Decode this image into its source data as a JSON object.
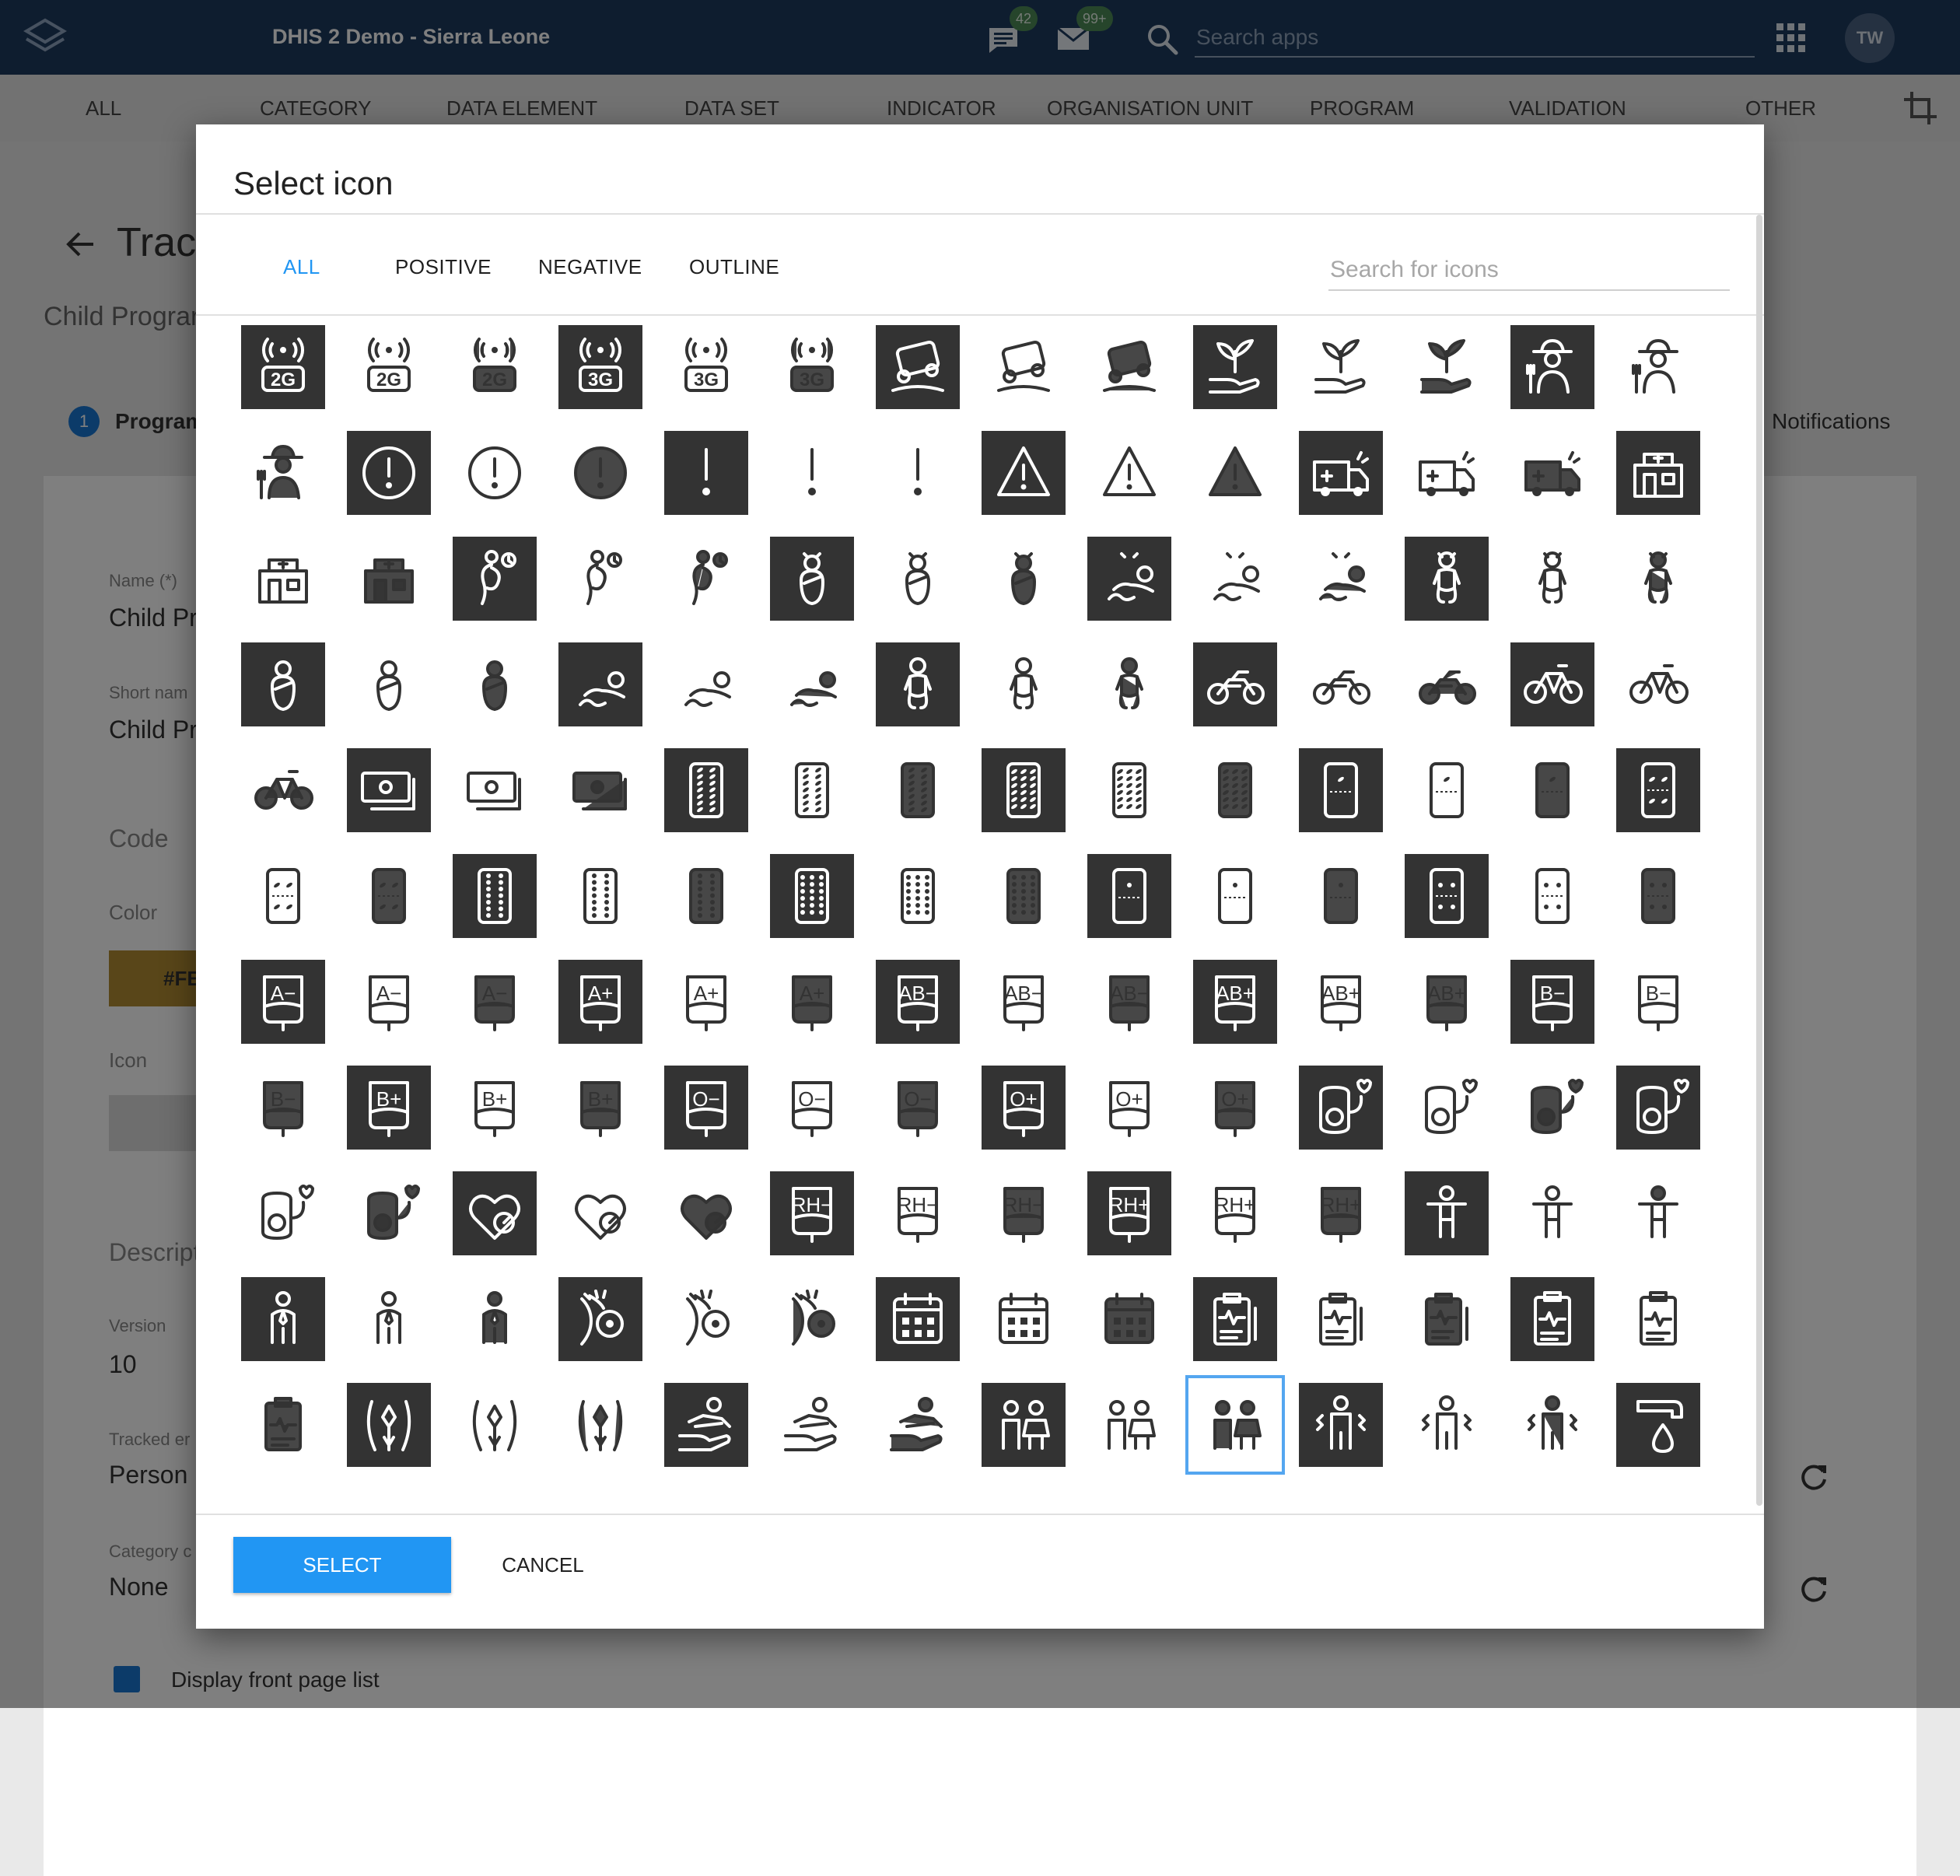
{
  "header": {
    "title": "DHIS 2 Demo - Sierra Leone",
    "messages_badge": "42",
    "interpretations_badge": "99+",
    "search_placeholder": "Search apps",
    "avatar_initials": "TW"
  },
  "top_tabs": [
    {
      "label": "ALL"
    },
    {
      "label": "CATEGORY"
    },
    {
      "label": "DATA ELEMENT"
    },
    {
      "label": "DATA SET"
    },
    {
      "label": "INDICATOR"
    },
    {
      "label": "ORGANISATION UNIT"
    },
    {
      "label": "PROGRAM"
    },
    {
      "label": "VALIDATION"
    },
    {
      "label": "OTHER"
    }
  ],
  "background": {
    "page_title": "Trac",
    "subtitle": "Child Prograr",
    "step_number": "1",
    "step_label": "Program",
    "notifications": "Notifications",
    "fields": {
      "name_label": "Name (*)",
      "name_value": "Child Pr",
      "short_label": "Short nam",
      "short_value": "Child Pr",
      "code_label": "Code",
      "color_label": "Color",
      "color_value": "#FE",
      "icon_label": "Icon",
      "description_label": "Descript",
      "version_label": "Version",
      "version_value": "10",
      "tracked_label": "Tracked er",
      "tracked_value": "Person",
      "category_label": "Category c",
      "category_value": "None",
      "checkbox_label": "Display front page list"
    }
  },
  "dialog": {
    "title": "Select icon",
    "filter_tabs": [
      {
        "label": "ALL",
        "active": true
      },
      {
        "label": "POSITIVE",
        "active": false
      },
      {
        "label": "NEGATIVE",
        "active": false
      },
      {
        "label": "OUTLINE",
        "active": false
      }
    ],
    "search_placeholder": "Search for icons",
    "select_label": "SELECT",
    "cancel_label": "CANCEL",
    "selected_icon": "children-negative",
    "icons": [
      [
        "2g-positive",
        "2g-outline",
        "2g-negative",
        "3g-positive",
        "3g-outline",
        "3g-negative",
        "4x4-positive",
        "4x4-outline",
        "4x4-negative",
        "agriculture-positive",
        "agriculture-outline",
        "agriculture-negative",
        "agriculture-worker-positive",
        "agriculture-worker-outline"
      ],
      [
        "agriculture-worker-negative",
        "alert-circle-positive",
        "alert-circle-outline",
        "alert-circle-negative",
        "alert-positive",
        "alert-outline",
        "alert-negative",
        "alert-triangle-positive",
        "alert-triangle-outline",
        "alert-triangle-negative",
        "ambulance-positive",
        "ambulance-outline",
        "ambulance-negative",
        "ambulatory-clinic-positive"
      ],
      [
        "ambulatory-clinic-outline",
        "ambulatory-clinic-negative",
        "ancv-positive",
        "ancv-outline",
        "ancv-negative",
        "baby-female-0203m-positive",
        "baby-female-0203m-outline",
        "baby-female-0203m-negative",
        "baby-female-0306m-positive",
        "baby-female-0306m-outline",
        "baby-female-0306m-negative",
        "baby-female-0609m-positive",
        "baby-female-0609m-outline",
        "baby-female-0609m-negative"
      ],
      [
        "baby-male-0203m-positive",
        "baby-male-0203m-outline",
        "baby-male-0203m-negative",
        "baby-male-0306m-positive",
        "baby-male-0306m-outline",
        "baby-male-0306m-negative",
        "baby-male-0609m-positive",
        "baby-male-0609m-outline",
        "baby-male-0609m-negative",
        "basic-motorcycle-positive",
        "basic-motorcycle-outline",
        "basic-motorcycle-negative",
        "bike-positive",
        "bike-outline"
      ],
      [
        "bike-negative",
        "bills-positive",
        "bills-outline",
        "bills-negative",
        "blister-pills-oval-x14-positive",
        "blister-pills-oval-x14-outline",
        "blister-pills-oval-x14-negative",
        "blister-pills-oval-x16-positive",
        "blister-pills-oval-x16-outline",
        "blister-pills-oval-x16-negative",
        "blister-pills-oval-x1-positive",
        "blister-pills-oval-x1-outline",
        "blister-pills-oval-x1-negative",
        "blister-pills-oval-x4-positive"
      ],
      [
        "blister-pills-oval-x4-outline",
        "blister-pills-oval-x4-negative",
        "blister-pills-round-x14-positive",
        "blister-pills-round-x14-outline",
        "blister-pills-round-x14-negative",
        "blister-pills-round-x16-positive",
        "blister-pills-round-x16-outline",
        "blister-pills-round-x16-negative",
        "blister-pills-round-x1-positive",
        "blister-pills-round-x1-outline",
        "blister-pills-round-x1-negative",
        "blister-pills-round-x4-positive",
        "blister-pills-round-x4-outline",
        "blister-pills-round-x4-negative"
      ],
      [
        "blood-a-n-positive",
        "blood-a-n-outline",
        "blood-a-n-negative",
        "blood-a-p-positive",
        "blood-a-p-outline",
        "blood-a-p-negative",
        "blood-ab-n-positive",
        "blood-ab-n-outline",
        "blood-ab-n-negative",
        "blood-ab-p-positive",
        "blood-ab-p-outline",
        "blood-ab-p-negative",
        "blood-b-n-positive",
        "blood-b-n-outline"
      ],
      [
        "blood-b-n-negative",
        "blood-b-p-positive",
        "blood-b-p-outline",
        "blood-b-p-negative",
        "blood-o-n-positive",
        "blood-o-n-outline",
        "blood-o-n-negative",
        "blood-o-p-positive",
        "blood-o-p-outline",
        "blood-o-p-negative",
        "blood-pressure-2-positive",
        "blood-pressure-2-outline",
        "blood-pressure-2-negative",
        "blood-pressure-positive"
      ],
      [
        "blood-pressure-outline",
        "blood-pressure-negative",
        "blood-pressure-monitor-positive",
        "blood-pressure-monitor-outline",
        "blood-pressure-monitor-negative",
        "blood-rh-n-positive",
        "blood-rh-n-outline",
        "blood-rh-n-negative",
        "blood-rh-p-positive",
        "blood-rh-p-outline",
        "blood-rh-p-negative",
        "body-positive",
        "body-outline",
        "body-negative"
      ],
      [
        "boy-1015y-positive",
        "boy-1015y-outline",
        "boy-1015y-negative",
        "breast-feeding-positive",
        "breast-feeding-outline",
        "breast-feeding-negative",
        "calendar-positive",
        "calendar-outline",
        "calendar-negative",
        "chart-health-positive",
        "chart-health-outline",
        "chart-health-negative",
        "clipboard-positive",
        "clipboard-outline"
      ],
      [
        "clipboard-negative",
        "cervical-positive",
        "cervical-outline",
        "cervical-negative",
        "child-care-positive",
        "child-care-outline",
        "child-care-negative",
        "children-positive",
        "children-outline",
        "children-negative",
        "chills-positive",
        "chills-outline",
        "chills-negative",
        "clean-water-positive"
      ]
    ]
  }
}
